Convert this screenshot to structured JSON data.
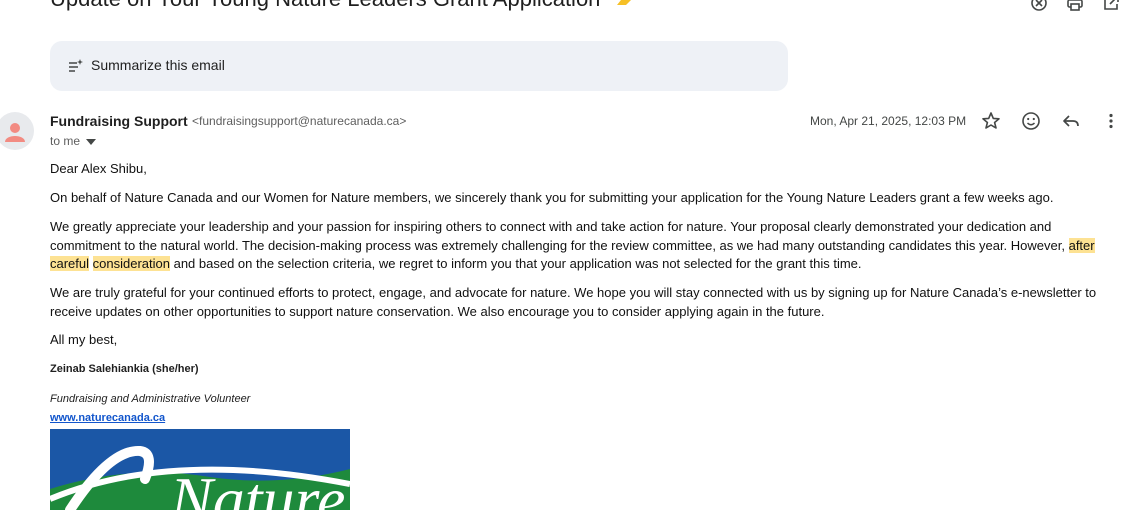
{
  "email": {
    "subject": "Update on Your Young Nature Leaders Grant Application",
    "summarize_label": "Summarize this email",
    "sender_name": "Fundraising Support",
    "sender_email": "<fundraisingsupport@naturecanada.ca>",
    "to_label": "to me",
    "date": "Mon, Apr 21, 2025, 12:03 PM",
    "greeting": "Dear Alex Shibu,",
    "para1": "On behalf of Nature Canada and our Women for Nature members, we sincerely thank you for submitting your application for the Young Nature Leaders grant a few weeks ago.",
    "para2_part1": "We greatly appreciate your leadership and your passion for inspiring others to connect with and take action for nature. Your proposal clearly demonstrated your dedication and commitment to the natural world. The decision-making process was extremely challenging for the review committee, as we had many outstanding candidates this year. However, ",
    "para2_hl1": "after",
    "para2_hl2": "careful",
    "para2_hl3": "consideration",
    "para2_part2": " and based on the selection criteria, we regret to inform you that your application was not selected for the grant this time.",
    "para3": "We are truly grateful for your continued efforts to protect, engage, and advocate for nature. We hope you will stay connected with us by signing up for Nature Canada’s e-newsletter to receive updates on other opportunities to support nature conservation. We also encourage you to consider applying again in the future.",
    "closing": "All my best,",
    "sig_name": "Zeinab Salehiankia (she/her)",
    "sig_role": "Fundraising and Administrative Volunteer",
    "sig_link": "www.naturecanada.ca",
    "logo_text": "Nature"
  },
  "icons": {
    "top": [
      "close-icon",
      "print-icon",
      "open-in-new-icon"
    ],
    "header": [
      "star-icon",
      "emoji-icon",
      "reply-icon",
      "more-vert-icon"
    ]
  },
  "colors": {
    "summarize_bg": "#eef1f6",
    "highlight": "#fde293",
    "link": "#1155cc",
    "logo_blue": "#1b57a6",
    "logo_green": "#1e8a3c"
  }
}
